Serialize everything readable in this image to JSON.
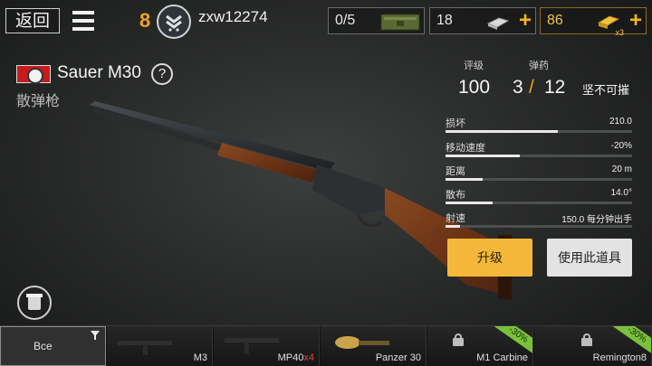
{
  "header": {
    "back_label": "返回",
    "rank_level": "8",
    "player_name": "zxw12274",
    "resources": [
      {
        "label": "0/5",
        "icon": "ammo-crate-icon"
      },
      {
        "label": "18",
        "icon": "silver-bars-icon"
      },
      {
        "label": "86",
        "icon": "gold-bars-icon",
        "multiplier": "x3"
      }
    ]
  },
  "weapon": {
    "name": "Sauer M30",
    "type": "散弹枪",
    "rating_label": "评级",
    "rating": "100",
    "ammo_label": "弹药",
    "ammo_current": "3",
    "ammo_sep": "/",
    "ammo_max": "12",
    "durability": "坚不可摧"
  },
  "stats": [
    {
      "label": "损坏",
      "value": "210.0",
      "level": 0.6
    },
    {
      "label": "移动速度",
      "value": "-20%",
      "level": 0.4
    },
    {
      "label": "距离",
      "value": "20 m",
      "level": 0.2
    },
    {
      "label": "散布",
      "value": "14.0°",
      "level": 0.25
    },
    {
      "label": "射速",
      "value": "150.0 每分钟出手",
      "level": 0.08
    }
  ],
  "buttons": {
    "upgrade": "升级",
    "use": "使用此道具"
  },
  "filter_label": "Все",
  "slots": [
    {
      "name": "M3",
      "locked": false
    },
    {
      "name": "MP40",
      "count": "x4",
      "locked": false
    },
    {
      "name": "Panzer 30",
      "locked": false
    },
    {
      "name": "M1 Carbine",
      "locked": true,
      "discount": "-30%"
    },
    {
      "name": "Remington8",
      "locked": true,
      "discount": "-30%"
    }
  ],
  "colors": {
    "accent": "#f5b73a",
    "rank": "#f0a21f",
    "discount": "#7ac13a"
  }
}
